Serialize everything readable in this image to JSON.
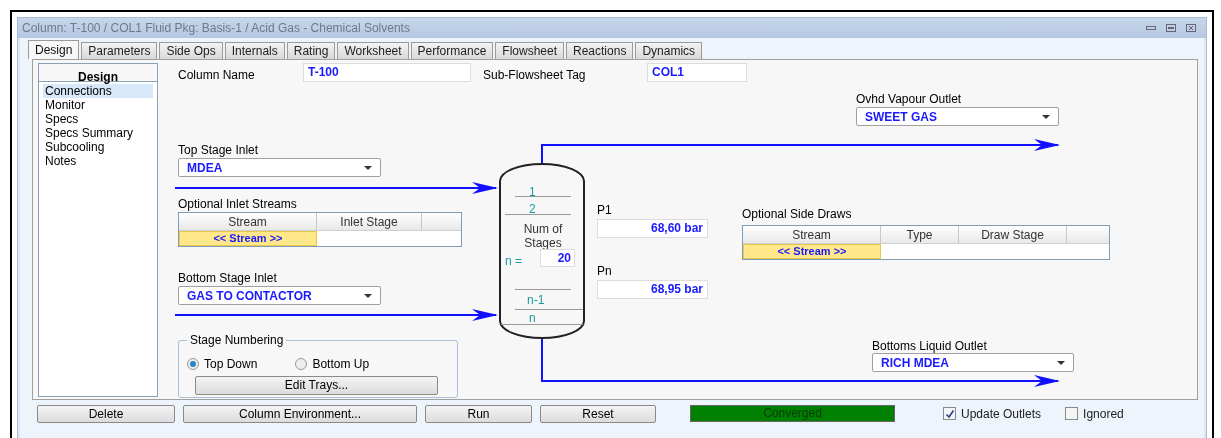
{
  "window": {
    "title": "Column: T-100 / COL1  Fluid Pkg: Basis-1 / Acid Gas - Chemical Solvents"
  },
  "tabs": [
    {
      "label": "Design",
      "selected": true
    },
    {
      "label": "Parameters",
      "selected": false
    },
    {
      "label": "Side Ops",
      "selected": false
    },
    {
      "label": "Internals",
      "selected": false
    },
    {
      "label": "Rating",
      "selected": false
    },
    {
      "label": "Worksheet",
      "selected": false
    },
    {
      "label": "Performance",
      "selected": false
    },
    {
      "label": "Flowsheet",
      "selected": false
    },
    {
      "label": "Reactions",
      "selected": false
    },
    {
      "label": "Dynamics",
      "selected": false
    }
  ],
  "sidebar": {
    "title": "Design",
    "items": [
      {
        "label": "Connections",
        "selected": true
      },
      {
        "label": "Monitor",
        "selected": false
      },
      {
        "label": "Specs",
        "selected": false
      },
      {
        "label": "Specs Summary",
        "selected": false
      },
      {
        "label": "Subcooling",
        "selected": false
      },
      {
        "label": "Notes",
        "selected": false
      }
    ]
  },
  "column_name": {
    "label": "Column Name",
    "value": "T-100"
  },
  "subflowsheet_tag": {
    "label": "Sub-Flowsheet Tag",
    "value": "COL1"
  },
  "ovhd_vapour_outlet": {
    "label": "Ovhd Vapour Outlet",
    "value": "SWEET GAS"
  },
  "top_stage_inlet": {
    "label": "Top Stage Inlet",
    "value": "MDEA"
  },
  "optional_inlet_streams": {
    "label": "Optional Inlet Streams",
    "columns": [
      "Stream",
      "Inlet Stage"
    ],
    "rows": [
      {
        "stream": "<< Stream >>"
      }
    ]
  },
  "bottom_stage_inlet": {
    "label": "Bottom Stage Inlet",
    "value": "GAS TO CONTACTOR"
  },
  "stage_numbering": {
    "label": "Stage Numbering",
    "options": [
      {
        "label": "Top Down",
        "selected": true
      },
      {
        "label": "Bottom Up",
        "selected": false
      }
    ],
    "button": "Edit Trays..."
  },
  "column_diagram": {
    "top_stage": "1",
    "second_stage": "2",
    "num_stages_label": "Num of Stages",
    "n_label": "n =",
    "n_value": "20",
    "second_last_stage": "n-1",
    "last_stage": "n"
  },
  "p1": {
    "label": "P1",
    "value": "68,60 bar"
  },
  "pn": {
    "label": "Pn",
    "value": "68,95 bar"
  },
  "optional_side_draws": {
    "label": "Optional Side Draws",
    "columns": [
      "Stream",
      "Type",
      "Draw Stage"
    ],
    "rows": [
      {
        "stream": "<< Stream >>"
      }
    ]
  },
  "bottoms_liquid_outlet": {
    "label": "Bottoms Liquid Outlet",
    "value": "RICH MDEA"
  },
  "buttons": [
    "Delete",
    "Column Environment...",
    "Run",
    "Reset"
  ],
  "status": {
    "text": "Converged",
    "color": "#008000"
  },
  "update_outlets": {
    "label": "Update Outlets",
    "checked": true
  },
  "ignored": {
    "label": "Ignored",
    "checked": false
  }
}
